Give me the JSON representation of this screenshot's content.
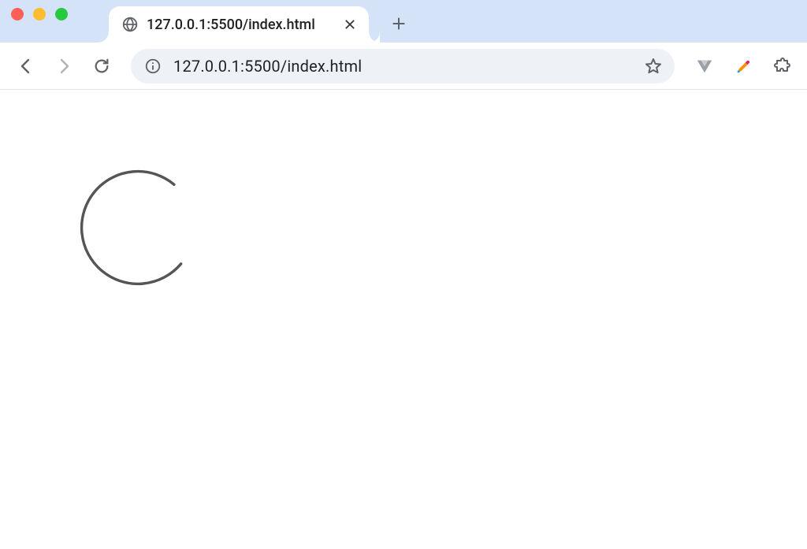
{
  "window": {
    "traffic_lights": {
      "close": "close",
      "minimize": "minimize",
      "maximize": "maximize"
    }
  },
  "tabs": [
    {
      "title": "127.0.0.1:5500/index.html",
      "favicon": "globe-icon"
    }
  ],
  "toolbar": {
    "back": "Back",
    "forward": "Forward",
    "reload": "Reload",
    "new_tab": "+"
  },
  "omnibox": {
    "info_tooltip": "View site information",
    "url": "127.0.0.1:5500/index.html",
    "bookmark_tooltip": "Bookmark this tab"
  },
  "extensions": [
    {
      "name": "vue-devtools-icon"
    },
    {
      "name": "color-picker-icon"
    },
    {
      "name": "extensions-puzzle-icon"
    }
  ],
  "page": {
    "spinner_label": "loading-spinner"
  }
}
